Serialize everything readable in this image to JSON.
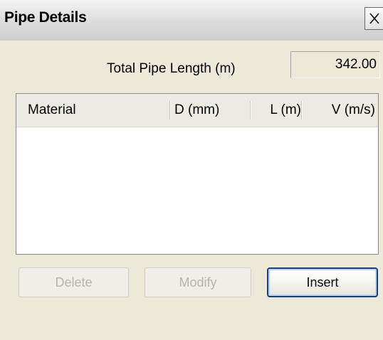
{
  "window": {
    "title": "Pipe Details",
    "close_glyph": "X"
  },
  "total": {
    "label": "Total Pipe Length (m)",
    "value": "342.00"
  },
  "table": {
    "columns": [
      "Material",
      "D (mm)",
      "L (m)",
      "V (m/s)"
    ],
    "rows": []
  },
  "buttons": {
    "delete": "Delete",
    "modify": "Modify",
    "insert": "Insert"
  },
  "colors": {
    "dialog_bg": "#ece9d8",
    "focus_border": "#1f3d6e",
    "disabled_text": "#b5b5ad"
  },
  "icons": {
    "close": "close-icon"
  }
}
